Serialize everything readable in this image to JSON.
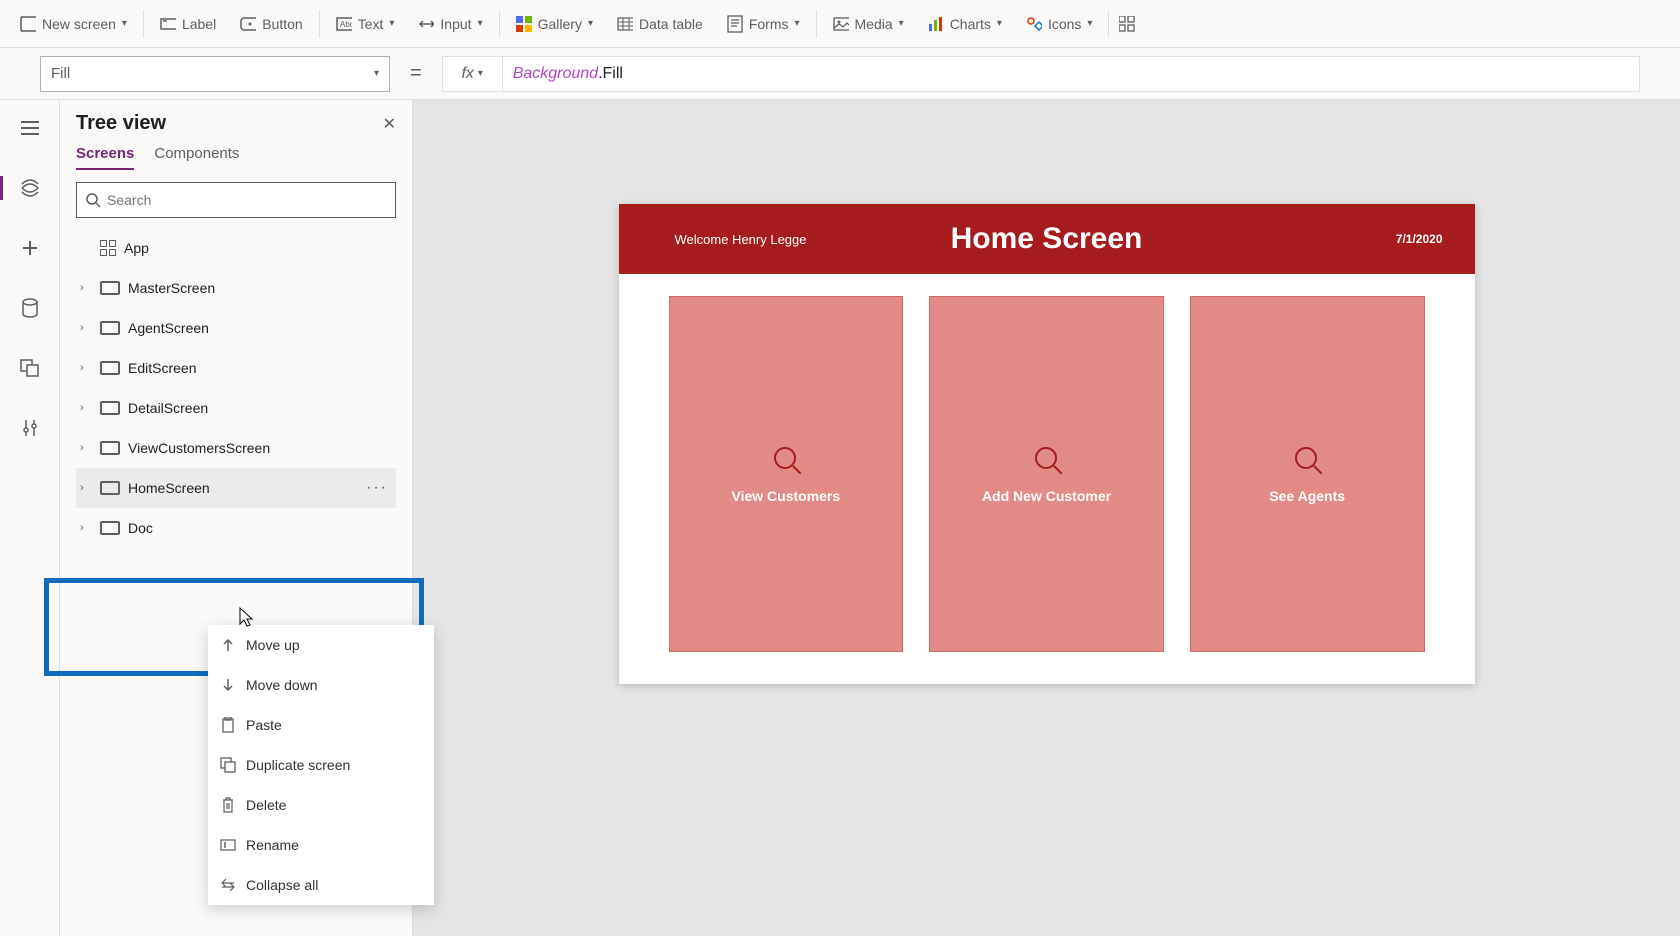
{
  "ribbon": {
    "new_screen": "New screen",
    "label": "Label",
    "button": "Button",
    "text": "Text",
    "input": "Input",
    "gallery": "Gallery",
    "data_table": "Data table",
    "forms": "Forms",
    "media": "Media",
    "charts": "Charts",
    "icons": "Icons"
  },
  "formula_bar": {
    "property": "Fill",
    "ref": "Background",
    "suffix": ".Fill"
  },
  "tree": {
    "title": "Tree view",
    "tabs": {
      "screens": "Screens",
      "components": "Components"
    },
    "search_placeholder": "Search",
    "app": "App",
    "items": [
      "MasterScreen",
      "AgentScreen",
      "EditScreen",
      "DetailScreen",
      "ViewCustomersScreen",
      "HomeScreen",
      "Doc"
    ]
  },
  "context_menu": {
    "move_up": "Move up",
    "move_down": "Move down",
    "paste": "Paste",
    "duplicate": "Duplicate screen",
    "delete": "Delete",
    "rename": "Rename",
    "collapse": "Collapse all"
  },
  "canvas": {
    "welcome": "Welcome Henry Legge",
    "title": "Home Screen",
    "date": "7/1/2020",
    "cards": [
      "View Customers",
      "Add New Customer",
      "See Agents"
    ]
  }
}
